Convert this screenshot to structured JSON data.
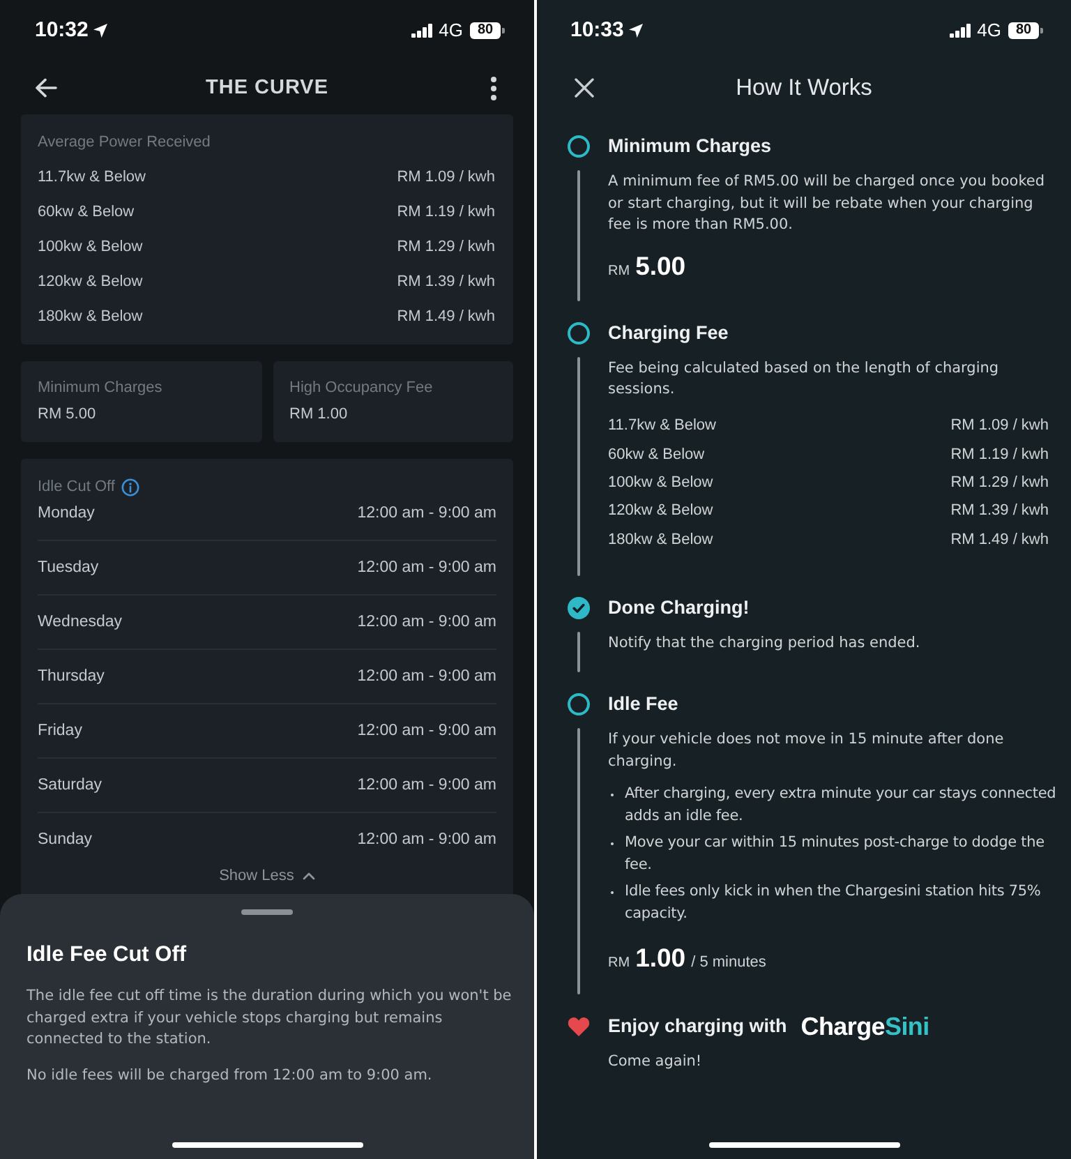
{
  "details_screen": {
    "status_bar": {
      "time": "10:32",
      "network": "4G",
      "battery": "80"
    },
    "header": {
      "title": "THE CURVE"
    },
    "power_card": {
      "label": "Average Power Received",
      "rates": [
        {
          "tier": "11.7kw & Below",
          "price": "RM 1.09 / kwh"
        },
        {
          "tier": "60kw & Below",
          "price": "RM 1.19 / kwh"
        },
        {
          "tier": "100kw & Below",
          "price": "RM 1.29 / kwh"
        },
        {
          "tier": "120kw & Below",
          "price": "RM 1.39 / kwh"
        },
        {
          "tier": "180kw & Below",
          "price": "RM 1.49 / kwh"
        }
      ]
    },
    "fee_cards": [
      {
        "label": "Minimum Charges",
        "value": "RM 5.00"
      },
      {
        "label": "High Occupancy Fee",
        "value": "RM 1.00"
      }
    ],
    "idle_card": {
      "label": "Idle Cut Off",
      "schedule": [
        {
          "day": "Monday",
          "hours": "12:00 am - 9:00 am"
        },
        {
          "day": "Tuesday",
          "hours": "12:00 am - 9:00 am"
        },
        {
          "day": "Wednesday",
          "hours": "12:00 am - 9:00 am"
        },
        {
          "day": "Thursday",
          "hours": "12:00 am - 9:00 am"
        },
        {
          "day": "Friday",
          "hours": "12:00 am - 9:00 am"
        },
        {
          "day": "Saturday",
          "hours": "12:00 am - 9:00 am"
        },
        {
          "day": "Sunday",
          "hours": "12:00 am - 9:00 am"
        }
      ],
      "toggle": "Show Less"
    },
    "sheet": {
      "title": "Idle Fee Cut Off",
      "paragraphs": [
        "The idle fee cut off time is the duration during which you won't be charged extra if your vehicle stops charging but remains connected to the station.",
        "No idle fees will be charged from 12:00 am to 9:00 am."
      ]
    }
  },
  "how_it_works_screen": {
    "status_bar": {
      "time": "10:33",
      "network": "4G",
      "battery": "80"
    },
    "header": {
      "title": "How It Works"
    },
    "steps": [
      {
        "kind": "step",
        "completed": false,
        "title": "Minimum Charges",
        "description": "A minimum fee of RM5.00 will be charged once you booked or start charging, but it will be rebate when your charging fee is more than RM5.00.",
        "amount": {
          "currency": "RM",
          "value": "5.00"
        }
      },
      {
        "kind": "step",
        "completed": false,
        "title": "Charging Fee",
        "description": "Fee being calculated based on the length of charging sessions.",
        "rates": [
          {
            "tier": "11.7kw & Below",
            "price": "RM 1.09 / kwh"
          },
          {
            "tier": "60kw & Below",
            "price": "RM 1.19 / kwh"
          },
          {
            "tier": "100kw & Below",
            "price": "RM 1.29 / kwh"
          },
          {
            "tier": "120kw & Below",
            "price": "RM 1.39 / kwh"
          },
          {
            "tier": "180kw & Below",
            "price": "RM 1.49 / kwh"
          }
        ]
      },
      {
        "kind": "step",
        "completed": true,
        "title": "Done Charging!",
        "description": "Notify that the charging period has ended."
      },
      {
        "kind": "step",
        "completed": false,
        "title": "Idle Fee",
        "description": "If your vehicle does not move in 15 minute after done charging.",
        "bullets": [
          "After charging, every extra minute your car stays connected adds an idle fee.",
          "Move your car within 15 minutes post-charge to dodge the fee.",
          "Idle fees only kick in when the Chargesini station hits 75% capacity."
        ],
        "amount": {
          "currency": "RM",
          "value": "1.00",
          "unit": "/ 5 minutes"
        }
      },
      {
        "kind": "closing",
        "title": "Enjoy charging with",
        "logo": {
          "text": "Charge",
          "accent": "Sini"
        },
        "description": "Come again!"
      }
    ]
  }
}
